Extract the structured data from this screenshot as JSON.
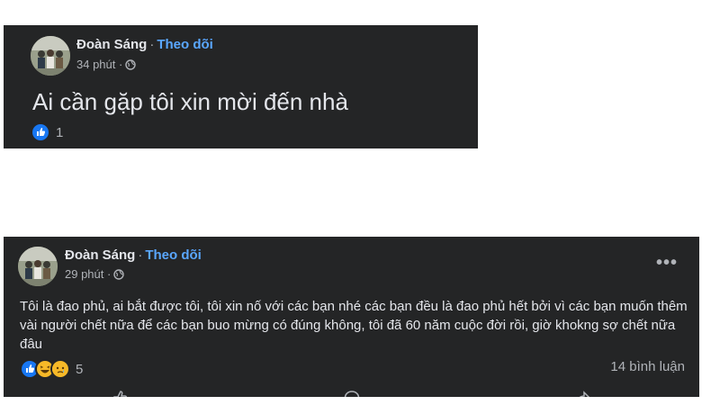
{
  "post1": {
    "author": "Đoàn Sáng",
    "separator": "·",
    "follow_label": "Theo dõi",
    "time": "34 phút ·",
    "content": "Ai cần gặp tôi xin mời đến nhà",
    "reaction_count": "1",
    "reactions": [
      "like-icon"
    ]
  },
  "post2": {
    "author": "Đoàn Sáng",
    "separator": "·",
    "follow_label": "Theo dõi",
    "time": "29 phút ·",
    "more_label": "•••",
    "content": "Tôi là đao phủ, ai bắt được tôi, tôi xin nố với các bạn nhé các bạn đều là đao phủ hết bởi vì các bạn muốn thêm vài người chết nữa để các bạn buo mừng có đúng không, tôi đã 60 năm cuộc đời rồi, giờ khokng sợ chết nữa đâu",
    "reaction_count": "5",
    "reactions": [
      "like-icon",
      "haha-icon",
      "sad-icon"
    ],
    "comments": "14 bình luận",
    "actions": [
      "like-action",
      "comment-action",
      "share-action"
    ]
  },
  "colors": {
    "card_bg": "#242526",
    "text_primary": "#e4e6eb",
    "text_secondary": "#b0b3b8",
    "follow_blue": "#5aa7ff",
    "like_blue": "#1877f2"
  }
}
